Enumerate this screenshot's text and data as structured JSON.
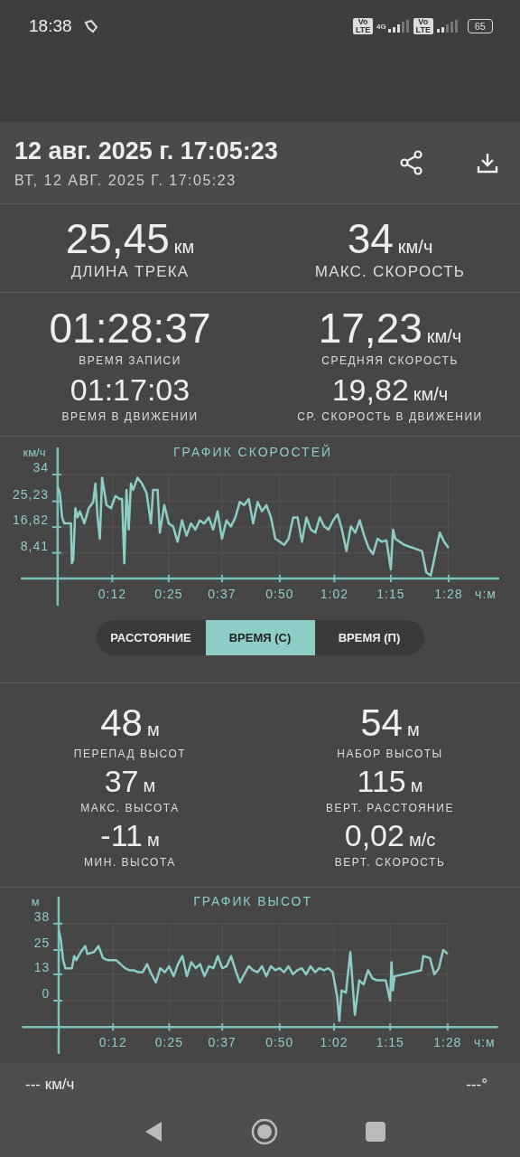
{
  "status_bar": {
    "time": "18:38",
    "volte_badges": [
      "Vo LTE",
      "Vo LTE"
    ],
    "network": "4G",
    "battery": "65"
  },
  "header": {
    "title": "12 авг. 2025 г. 17:05:23",
    "subtitle": "ВТ, 12 АВГ. 2025 Г. 17:05:23"
  },
  "track_stats": [
    {
      "rows": [
        [
          {
            "value": "25,45",
            "unit": "км",
            "label": "ДЛИНА ТРЕКА"
          },
          {
            "value": "34",
            "unit": "км/ч",
            "label": "МАКС. СКОРОСТЬ"
          }
        ]
      ]
    },
    {
      "rows": [
        [
          {
            "value": "01:28:37",
            "label": "ВРЕМЯ ЗАПИСИ"
          },
          {
            "value": "17,23",
            "unit": "км/ч",
            "label": "СРЕДНЯЯ СКОРОСТЬ"
          }
        ],
        [
          {
            "value": "01:17:03",
            "label": "ВРЕМЯ В ДВИЖЕНИИ"
          },
          {
            "value": "19,82",
            "unit": "км/ч",
            "label": "СР. СКОРОСТЬ В ДВИЖЕНИИ"
          }
        ]
      ]
    }
  ],
  "speed_chart": {
    "chart_data": {
      "type": "line",
      "title": "ГРАФИК СКОРОСТЕЙ",
      "ylabel": "км/ч",
      "xlabel": "ч:м",
      "grid": true,
      "xlim": [
        -8.3,
        99.4
      ],
      "ylim": [
        0,
        34
      ],
      "x": [
        0,
        0.5,
        1,
        1.5,
        3,
        3.2,
        3.5,
        4,
        4.5,
        5,
        6,
        7,
        8,
        8.5,
        9,
        9.5,
        10,
        11,
        12,
        13,
        14,
        14.5,
        15,
        15.5,
        16,
        16.5,
        17,
        18,
        19,
        20,
        21,
        21.5,
        22.5,
        23,
        24,
        25,
        26,
        27,
        28,
        29,
        30,
        31,
        32,
        33,
        34,
        35,
        36,
        37,
        38,
        39,
        40,
        41,
        42,
        43,
        44,
        45,
        46,
        47,
        48,
        49,
        50,
        51,
        52,
        53,
        54,
        55,
        56,
        57,
        58,
        59,
        60,
        61,
        62,
        63,
        64,
        65,
        66,
        67,
        68,
        69,
        70,
        71,
        72,
        73,
        74,
        75,
        75.5,
        76,
        77,
        78,
        82,
        83,
        84,
        85,
        86,
        87,
        88
      ],
      "series": [
        {
          "color": "#8ecdc6",
          "values": [
            30,
            28,
            20,
            18,
            18,
            5,
            6,
            23,
            20,
            22,
            18,
            23,
            25,
            31,
            20,
            13,
            33,
            24,
            23,
            27,
            26,
            26,
            5,
            29,
            16,
            31,
            29,
            33,
            31,
            28,
            18,
            29,
            29,
            15,
            24,
            18,
            17,
            12,
            19,
            14,
            18,
            16,
            19,
            18,
            20,
            16,
            22,
            13,
            19,
            17,
            20,
            25,
            24,
            26,
            18,
            25,
            22,
            24,
            20,
            13,
            12,
            11,
            13,
            20,
            20,
            12,
            20,
            16,
            15,
            20,
            17,
            16,
            19,
            21,
            16,
            9,
            17,
            15,
            19,
            14,
            10,
            8,
            13,
            12,
            12.5,
            3,
            16,
            13,
            12,
            11,
            9,
            2,
            1,
            8,
            15,
            12,
            10
          ]
        }
      ],
      "xticks": [
        {
          "value": 12.3,
          "label": "0:12"
        },
        {
          "value": 25,
          "label": "0:25"
        },
        {
          "value": 37,
          "label": "0:37"
        },
        {
          "value": 50,
          "label": "0:50"
        },
        {
          "value": 62.3,
          "label": "1:02"
        },
        {
          "value": 75,
          "label": "1:15"
        },
        {
          "value": 88,
          "label": "1:28"
        }
      ],
      "yticks": [
        {
          "value": 8.41,
          "label": "8,41"
        },
        {
          "value": 16.82,
          "label": "16,82"
        },
        {
          "value": 25.23,
          "label": "25,23"
        },
        {
          "value": 34,
          "label": "34"
        }
      ]
    }
  },
  "mode_tabs": [
    {
      "label": "РАССТОЯНИЕ",
      "selected": false
    },
    {
      "label": "ВРЕМЯ (С)",
      "selected": true
    },
    {
      "label": "ВРЕМЯ (П)",
      "selected": false
    }
  ],
  "altitude_stats": [
    [
      {
        "value": "48",
        "unit": "м",
        "label": "ПЕРЕПАД ВЫСОТ"
      },
      {
        "value": "54",
        "unit": "м",
        "label": "НАБОР ВЫСОТЫ"
      }
    ],
    [
      {
        "value": "37",
        "unit": "м",
        "label": "МАКС. ВЫСОТА"
      },
      {
        "value": "115",
        "unit": "м",
        "label": "ВЕРТ. РАССТОЯНИЕ"
      }
    ],
    [
      {
        "value": "-11",
        "unit": "м",
        "label": "МИН. ВЫСОТА"
      },
      {
        "value": "0,02",
        "unit": "м/с",
        "label": "ВЕРТ. СКОРОСТЬ"
      }
    ]
  ],
  "altitude_chart": {
    "chart_data": {
      "type": "line",
      "title": "ГРАФИК ВЫСОТ",
      "ylabel": "м",
      "xlabel": "ч:м",
      "grid": true,
      "xlim": [
        -8.3,
        99.4
      ],
      "ylim": [
        -13,
        38
      ],
      "x": [
        0,
        0.5,
        1,
        1.5,
        3,
        3.5,
        4,
        5,
        6,
        6.5,
        8,
        9,
        10,
        11,
        13,
        14,
        15,
        16,
        17,
        18,
        19,
        20,
        21,
        22,
        23,
        24,
        25,
        26,
        27,
        28,
        29,
        30,
        31,
        32,
        33,
        34,
        35,
        36,
        37,
        38,
        39,
        40,
        41,
        42,
        43,
        44,
        45,
        46,
        47,
        48,
        49,
        50,
        51,
        52,
        53,
        54,
        55,
        56,
        57,
        58,
        59,
        60,
        61,
        62,
        63,
        63.5,
        64,
        65,
        66,
        67,
        68,
        69,
        70,
        71,
        72,
        73,
        74,
        75,
        75.3,
        75.6,
        76,
        82,
        82.5,
        84,
        85,
        86,
        87,
        88
      ],
      "series": [
        {
          "color": "#8ecdc6",
          "values": [
            35,
            30,
            20,
            16,
            16,
            22,
            20,
            24,
            27,
            23,
            24,
            27,
            21,
            20,
            20,
            18,
            16,
            15,
            15,
            14,
            14,
            18,
            13,
            9,
            16,
            14,
            17,
            12,
            18,
            22,
            12,
            19,
            16,
            18,
            12,
            17,
            16,
            22,
            16,
            17,
            22,
            15,
            9,
            13,
            17,
            15,
            14,
            17,
            12,
            17,
            15,
            16,
            14,
            17,
            13,
            15,
            16,
            13,
            17,
            14,
            16,
            15,
            16,
            14,
            2,
            -10,
            5,
            4,
            24,
            -7,
            10,
            8,
            15,
            11,
            10,
            10,
            10,
            0,
            19,
            5,
            12,
            15,
            22,
            21,
            13,
            16,
            25,
            23
          ]
        }
      ],
      "xticks": [
        {
          "value": 12.3,
          "label": "0:12"
        },
        {
          "value": 25,
          "label": "0:25"
        },
        {
          "value": 37,
          "label": "0:37"
        },
        {
          "value": 50,
          "label": "0:50"
        },
        {
          "value": 62.3,
          "label": "1:02"
        },
        {
          "value": 75,
          "label": "1:15"
        },
        {
          "value": 88,
          "label": "1:28"
        }
      ],
      "yticks": [
        {
          "value": 0,
          "label": "0"
        },
        {
          "value": 13,
          "label": "13"
        },
        {
          "value": 25,
          "label": "25"
        },
        {
          "value": 38,
          "label": "38"
        }
      ]
    }
  },
  "bottom_bar": {
    "speed": "--- км/ч",
    "heading": "---°"
  }
}
